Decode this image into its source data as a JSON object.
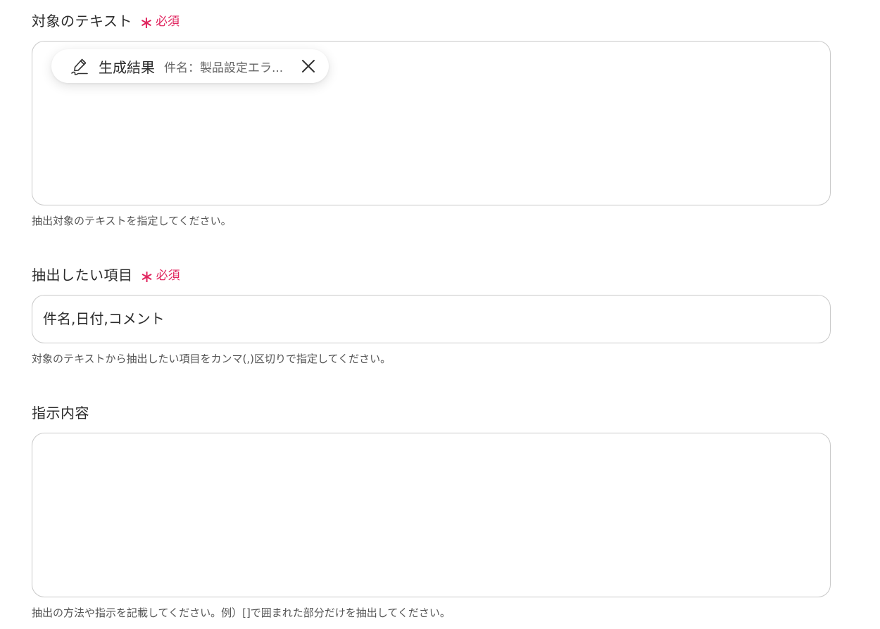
{
  "fields": {
    "target_text": {
      "label": "対象のテキスト",
      "required_label": "必須",
      "chip": {
        "icon": "pen-icon",
        "title": "生成結果",
        "value": "件名：製品設定エラ..."
      },
      "help": "抽出対象のテキストを指定してください。"
    },
    "items": {
      "label": "抽出したい項目",
      "required_label": "必須",
      "value": "件名,日付,コメント",
      "help": "対象のテキストから抽出したい項目をカンマ(,)区切りで指定してください。"
    },
    "instructions": {
      "label": "指示内容",
      "value": "",
      "help": "抽出の方法や指示を記載してください。例）[]で囲まれた部分だけを抽出してください。"
    }
  },
  "colors": {
    "required": "#e0245e",
    "border": "#c9c9c9",
    "help_text": "#555555"
  }
}
